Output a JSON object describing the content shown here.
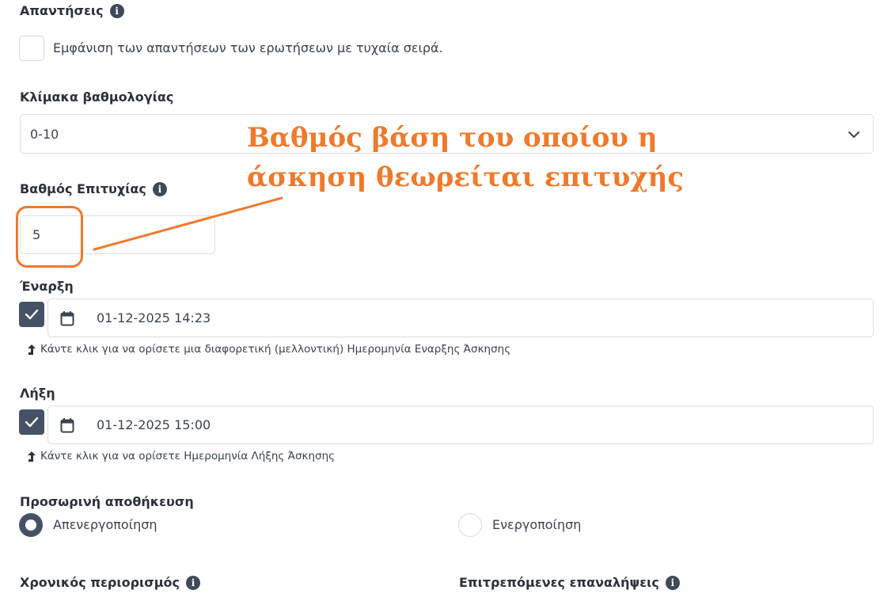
{
  "answers": {
    "heading": "Απαντήσεις",
    "shuffle_label": "Εμφάνιση των απαντήσεων των ερωτήσεων με τυχαία σειρά.",
    "shuffle_checked": false
  },
  "grading_scale": {
    "heading": "Κλίμακα βαθμολογίας",
    "selected": "0-10"
  },
  "pass_grade": {
    "heading": "Βαθμός Επιτυχίας",
    "value": "5"
  },
  "start": {
    "heading": "Έναρξη",
    "checked": true,
    "datetime": "01-12-2025 14:23",
    "hint": "Κάντε κλικ για να ορίσετε μια διαφορετική (μελλοντική) Ημερομηνία Εναρξης Άσκησης"
  },
  "end": {
    "heading": "Λήξη",
    "checked": true,
    "datetime": "01-12-2025 15:00",
    "hint": "Κάντε κλικ για να ορίσετε Ημερομηνία Λήξης Άσκησης"
  },
  "temp_save": {
    "heading": "Προσωρινή αποθήκευση",
    "options": [
      "Απενεργοποίηση",
      "Ενεργοποίηση"
    ],
    "selected_index": 0
  },
  "time_limit": {
    "heading": "Χρονικός περιορισμός"
  },
  "allowed_repeats": {
    "heading": "Επιτρεπόμενες επαναλήψεις"
  },
  "annotation": {
    "line1": "Βαθμός βάση του οποίου  η",
    "line2": "άσκηση θεωρείται επιτυχής",
    "color": "#ee7a2c"
  },
  "colors": {
    "accent": "#455266",
    "border": "#d9dde2",
    "text": "#3a4351"
  },
  "icons": {
    "info": "i"
  }
}
